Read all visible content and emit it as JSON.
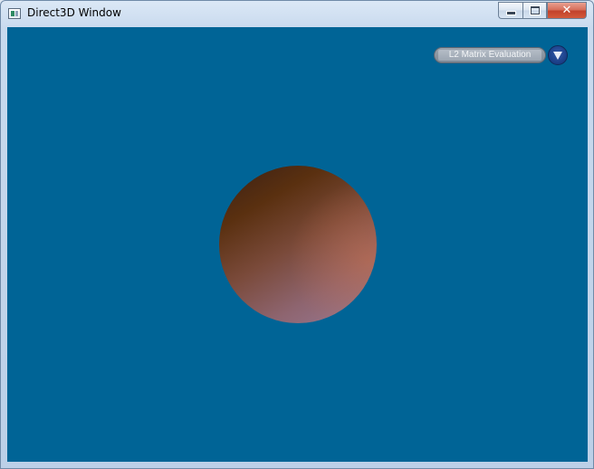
{
  "window": {
    "title": "Direct3D Window",
    "icon": "application-icon",
    "caption_buttons": {
      "minimize": "minimize-icon",
      "maximize": "maximize-icon",
      "close_label": "✕"
    }
  },
  "viewport": {
    "background_color": "#006496",
    "scene": {
      "object": "sphere",
      "colors": [
        "#3a2015",
        "#5a3010",
        "#8e6570",
        "#9a7a95"
      ]
    },
    "dropdown": {
      "selected": "L2 Matrix Evaluation",
      "arrow_icon": "chevron-down-icon"
    }
  }
}
